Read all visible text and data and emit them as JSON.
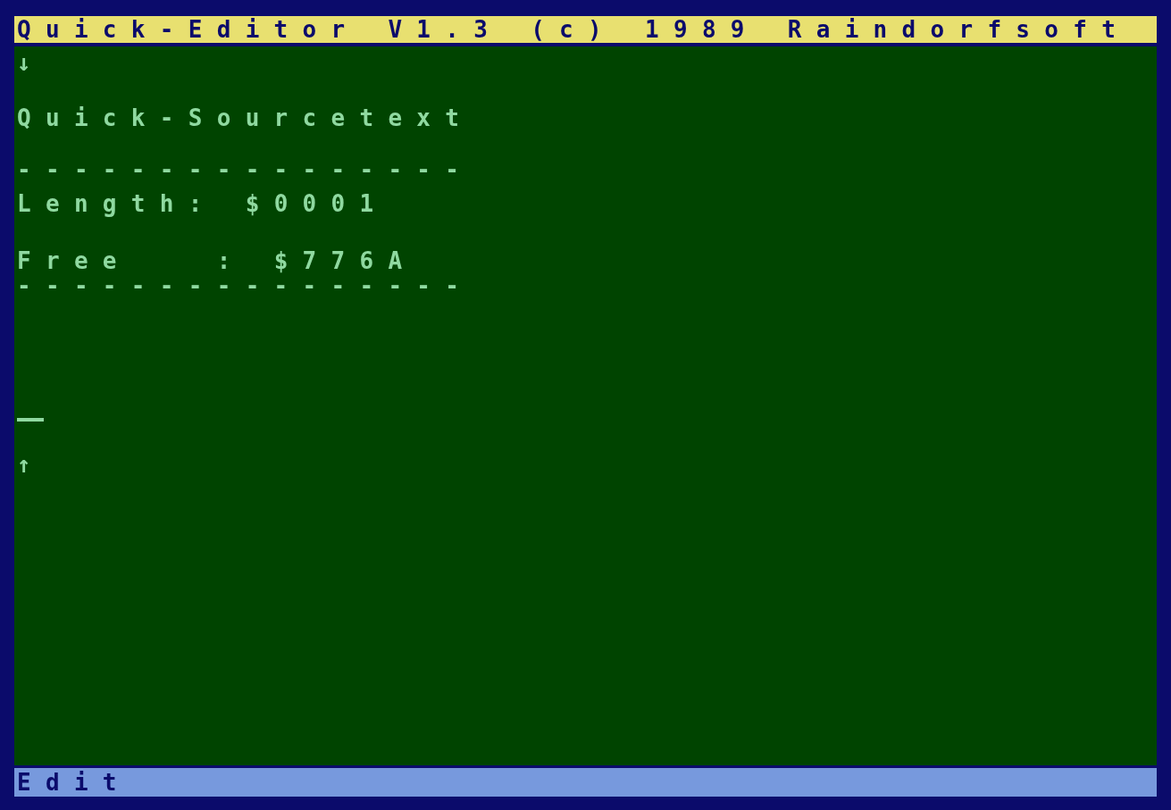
{
  "title_bar": {
    "title": "Quick-Editor V1.3 (c) 1989 Raindorfsoft"
  },
  "editor": {
    "top_arrow": "↓",
    "heading": "Quick-Sourcetext",
    "rule_top": "----------------",
    "length": {
      "label": "Length:",
      "value": "$0001"
    },
    "free": {
      "label": "Free   :",
      "value": "$776A"
    },
    "rule_bottom": "----------------",
    "bottom_arrow": "↑"
  },
  "status_bar": {
    "mode": "Edit"
  }
}
